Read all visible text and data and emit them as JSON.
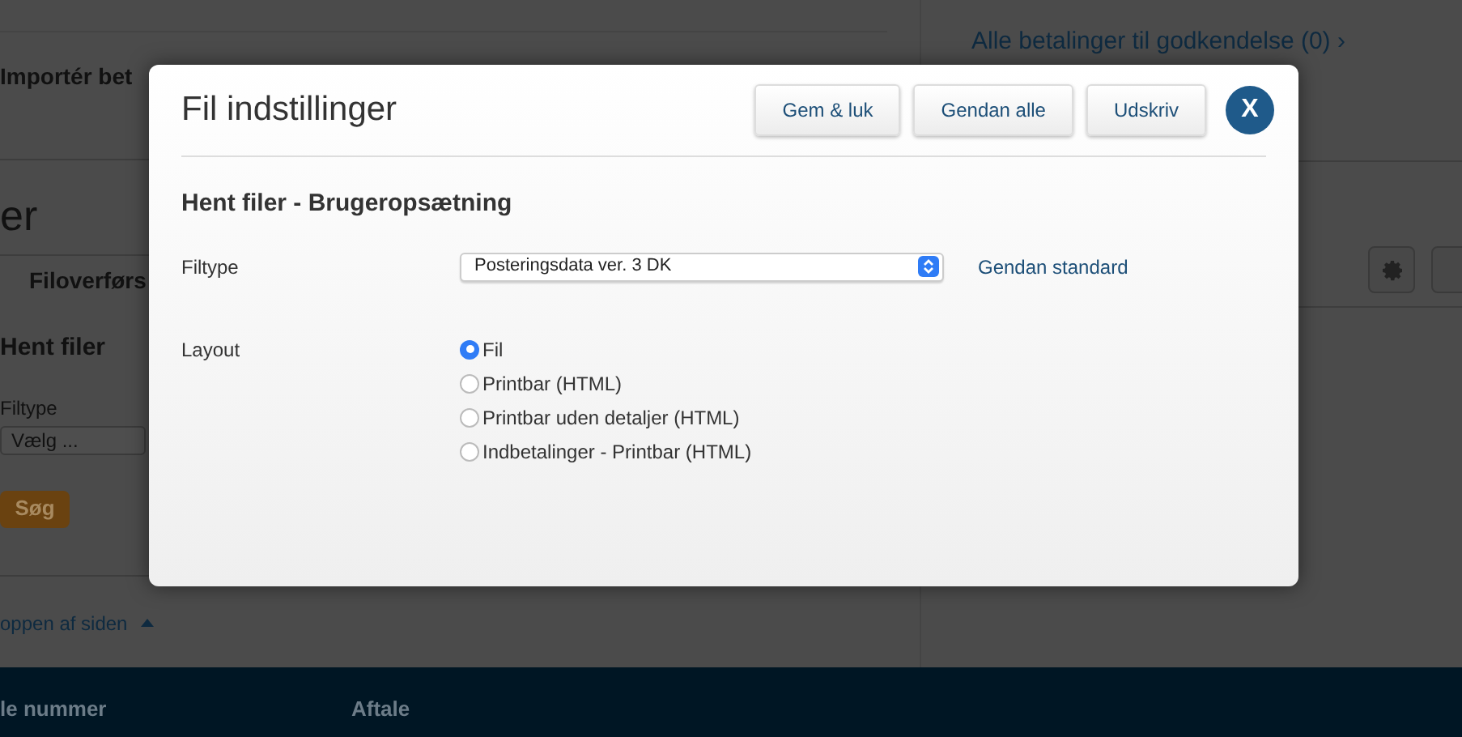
{
  "background_page": {
    "import_heading": "Importér bet",
    "approvals_link": "Alle betalinger til godkendelse (0) ›",
    "page_title": "er",
    "tab": "Filoverførs",
    "section_heading": "Hent filer",
    "filter_label": "Filtype",
    "filter_select": "Vælg ...",
    "search_button": "Søg",
    "back_to_top": "oppen af siden",
    "footer": {
      "column_1": "le nummer",
      "column_2": "Aftale"
    }
  },
  "dialog": {
    "title": "Fil indstillinger",
    "buttons": [
      "Gem & luk",
      "Gendan alle",
      "Udskriv"
    ],
    "close_button": "X",
    "section_title": "Hent filer - Brugeropsætning",
    "filetype": {
      "label": "Filtype",
      "value": "Posteringsdata ver. 3 DK",
      "reset_link": "Gendan standard"
    },
    "layout": {
      "label": "Layout",
      "options": [
        {
          "label": "Fil",
          "selected": true
        },
        {
          "label": "Printbar (HTML)",
          "selected": false
        },
        {
          "label": "Printbar uden detaljer (HTML)",
          "selected": false
        },
        {
          "label": "Indbetalinger - Printbar (HTML)",
          "selected": false
        }
      ]
    }
  }
}
